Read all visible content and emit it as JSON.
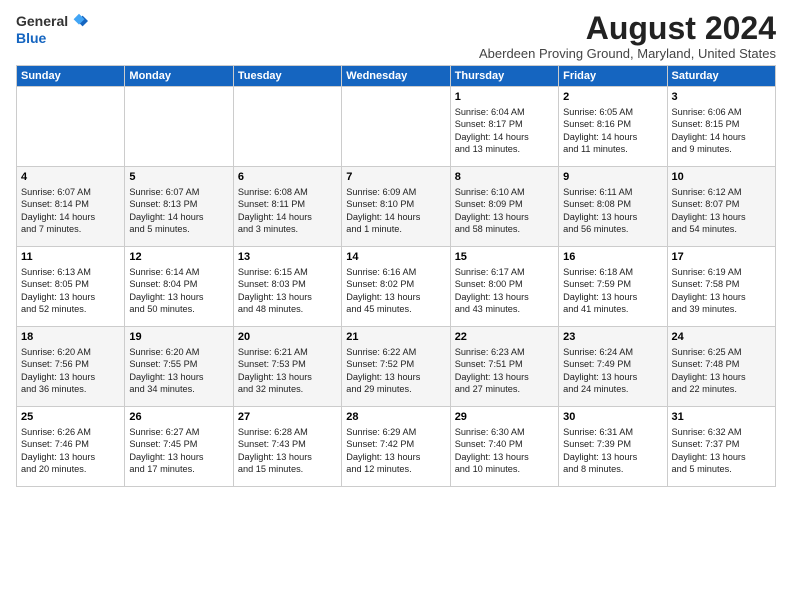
{
  "header": {
    "logo": {
      "general": "General",
      "blue": "Blue"
    },
    "title": "August 2024",
    "location": "Aberdeen Proving Ground, Maryland, United States"
  },
  "weekdays": [
    "Sunday",
    "Monday",
    "Tuesday",
    "Wednesday",
    "Thursday",
    "Friday",
    "Saturday"
  ],
  "weeks": [
    [
      {
        "day": "",
        "info": ""
      },
      {
        "day": "",
        "info": ""
      },
      {
        "day": "",
        "info": ""
      },
      {
        "day": "",
        "info": ""
      },
      {
        "day": "1",
        "info": "Sunrise: 6:04 AM\nSunset: 8:17 PM\nDaylight: 14 hours\nand 13 minutes."
      },
      {
        "day": "2",
        "info": "Sunrise: 6:05 AM\nSunset: 8:16 PM\nDaylight: 14 hours\nand 11 minutes."
      },
      {
        "day": "3",
        "info": "Sunrise: 6:06 AM\nSunset: 8:15 PM\nDaylight: 14 hours\nand 9 minutes."
      }
    ],
    [
      {
        "day": "4",
        "info": "Sunrise: 6:07 AM\nSunset: 8:14 PM\nDaylight: 14 hours\nand 7 minutes."
      },
      {
        "day": "5",
        "info": "Sunrise: 6:07 AM\nSunset: 8:13 PM\nDaylight: 14 hours\nand 5 minutes."
      },
      {
        "day": "6",
        "info": "Sunrise: 6:08 AM\nSunset: 8:11 PM\nDaylight: 14 hours\nand 3 minutes."
      },
      {
        "day": "7",
        "info": "Sunrise: 6:09 AM\nSunset: 8:10 PM\nDaylight: 14 hours\nand 1 minute."
      },
      {
        "day": "8",
        "info": "Sunrise: 6:10 AM\nSunset: 8:09 PM\nDaylight: 13 hours\nand 58 minutes."
      },
      {
        "day": "9",
        "info": "Sunrise: 6:11 AM\nSunset: 8:08 PM\nDaylight: 13 hours\nand 56 minutes."
      },
      {
        "day": "10",
        "info": "Sunrise: 6:12 AM\nSunset: 8:07 PM\nDaylight: 13 hours\nand 54 minutes."
      }
    ],
    [
      {
        "day": "11",
        "info": "Sunrise: 6:13 AM\nSunset: 8:05 PM\nDaylight: 13 hours\nand 52 minutes."
      },
      {
        "day": "12",
        "info": "Sunrise: 6:14 AM\nSunset: 8:04 PM\nDaylight: 13 hours\nand 50 minutes."
      },
      {
        "day": "13",
        "info": "Sunrise: 6:15 AM\nSunset: 8:03 PM\nDaylight: 13 hours\nand 48 minutes."
      },
      {
        "day": "14",
        "info": "Sunrise: 6:16 AM\nSunset: 8:02 PM\nDaylight: 13 hours\nand 45 minutes."
      },
      {
        "day": "15",
        "info": "Sunrise: 6:17 AM\nSunset: 8:00 PM\nDaylight: 13 hours\nand 43 minutes."
      },
      {
        "day": "16",
        "info": "Sunrise: 6:18 AM\nSunset: 7:59 PM\nDaylight: 13 hours\nand 41 minutes."
      },
      {
        "day": "17",
        "info": "Sunrise: 6:19 AM\nSunset: 7:58 PM\nDaylight: 13 hours\nand 39 minutes."
      }
    ],
    [
      {
        "day": "18",
        "info": "Sunrise: 6:20 AM\nSunset: 7:56 PM\nDaylight: 13 hours\nand 36 minutes."
      },
      {
        "day": "19",
        "info": "Sunrise: 6:20 AM\nSunset: 7:55 PM\nDaylight: 13 hours\nand 34 minutes."
      },
      {
        "day": "20",
        "info": "Sunrise: 6:21 AM\nSunset: 7:53 PM\nDaylight: 13 hours\nand 32 minutes."
      },
      {
        "day": "21",
        "info": "Sunrise: 6:22 AM\nSunset: 7:52 PM\nDaylight: 13 hours\nand 29 minutes."
      },
      {
        "day": "22",
        "info": "Sunrise: 6:23 AM\nSunset: 7:51 PM\nDaylight: 13 hours\nand 27 minutes."
      },
      {
        "day": "23",
        "info": "Sunrise: 6:24 AM\nSunset: 7:49 PM\nDaylight: 13 hours\nand 24 minutes."
      },
      {
        "day": "24",
        "info": "Sunrise: 6:25 AM\nSunset: 7:48 PM\nDaylight: 13 hours\nand 22 minutes."
      }
    ],
    [
      {
        "day": "25",
        "info": "Sunrise: 6:26 AM\nSunset: 7:46 PM\nDaylight: 13 hours\nand 20 minutes."
      },
      {
        "day": "26",
        "info": "Sunrise: 6:27 AM\nSunset: 7:45 PM\nDaylight: 13 hours\nand 17 minutes."
      },
      {
        "day": "27",
        "info": "Sunrise: 6:28 AM\nSunset: 7:43 PM\nDaylight: 13 hours\nand 15 minutes."
      },
      {
        "day": "28",
        "info": "Sunrise: 6:29 AM\nSunset: 7:42 PM\nDaylight: 13 hours\nand 12 minutes."
      },
      {
        "day": "29",
        "info": "Sunrise: 6:30 AM\nSunset: 7:40 PM\nDaylight: 13 hours\nand 10 minutes."
      },
      {
        "day": "30",
        "info": "Sunrise: 6:31 AM\nSunset: 7:39 PM\nDaylight: 13 hours\nand 8 minutes."
      },
      {
        "day": "31",
        "info": "Sunrise: 6:32 AM\nSunset: 7:37 PM\nDaylight: 13 hours\nand 5 minutes."
      }
    ]
  ]
}
